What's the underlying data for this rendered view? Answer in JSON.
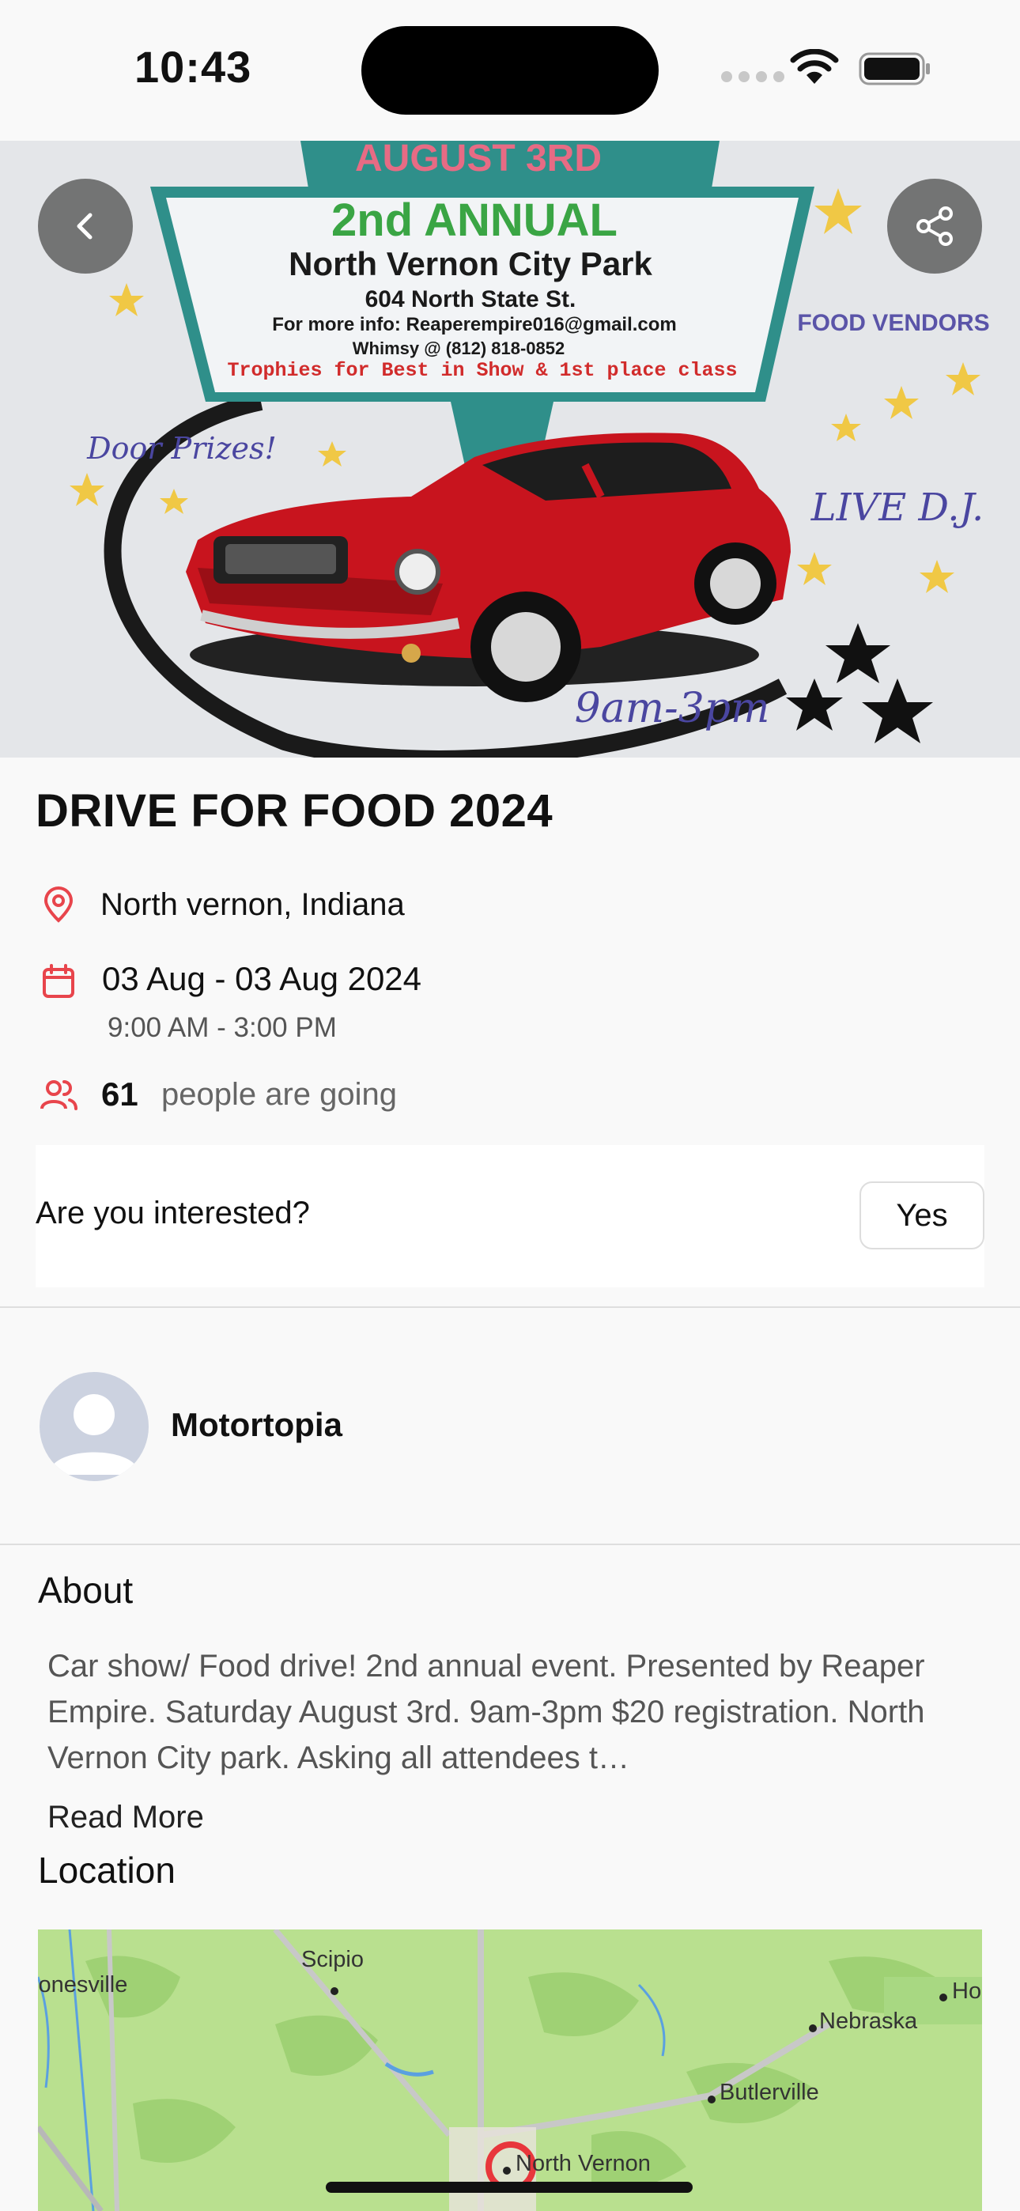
{
  "status_bar": {
    "time": "10:43"
  },
  "hero": {
    "poster_text": {
      "date": "AUGUST 3RD",
      "annual": "2nd ANNUAL",
      "venue": "North Vernon City Park",
      "address": "604 North State St.",
      "info": "For more info: Reaperempire016@gmail.com",
      "phone": "Whimsy @ (812) 818-0852",
      "trophies": "Trophies for Best in Show & 1st place class",
      "food": "FOOD VENDORS",
      "door": "Door Prizes!",
      "dj": "LIVE D.J.",
      "hours": "9am-3pm"
    },
    "car_color": "#c8141e"
  },
  "event": {
    "title": "DRIVE FOR FOOD 2024",
    "location": "North vernon, Indiana",
    "date_range": "03 Aug - 03 Aug 2024",
    "time_range": "9:00 AM - 3:00 PM",
    "going_count": "61",
    "going_text": "people are going"
  },
  "interest": {
    "question": "Are you interested?",
    "yes_label": "Yes"
  },
  "organizer": {
    "name": "Motortopia"
  },
  "about": {
    "title": "About",
    "text": "Car show/ Food drive! 2nd annual event. Presented by Reaper Empire. Saturday August 3rd. 9am-3pm $20 registration. North Vernon City park. Asking all attendees t…",
    "read_more": "Read More"
  },
  "location": {
    "title": "Location",
    "map_labels": {
      "scipio": "Scipio",
      "jonesville": "Jonesville",
      "nebraska": "Nebraska",
      "ho": "Ho",
      "butlerville": "Butlerville",
      "north_vernon": "North Vernon"
    }
  },
  "colors": {
    "accent": "#e8454c",
    "map_green": "#b9e08f"
  }
}
